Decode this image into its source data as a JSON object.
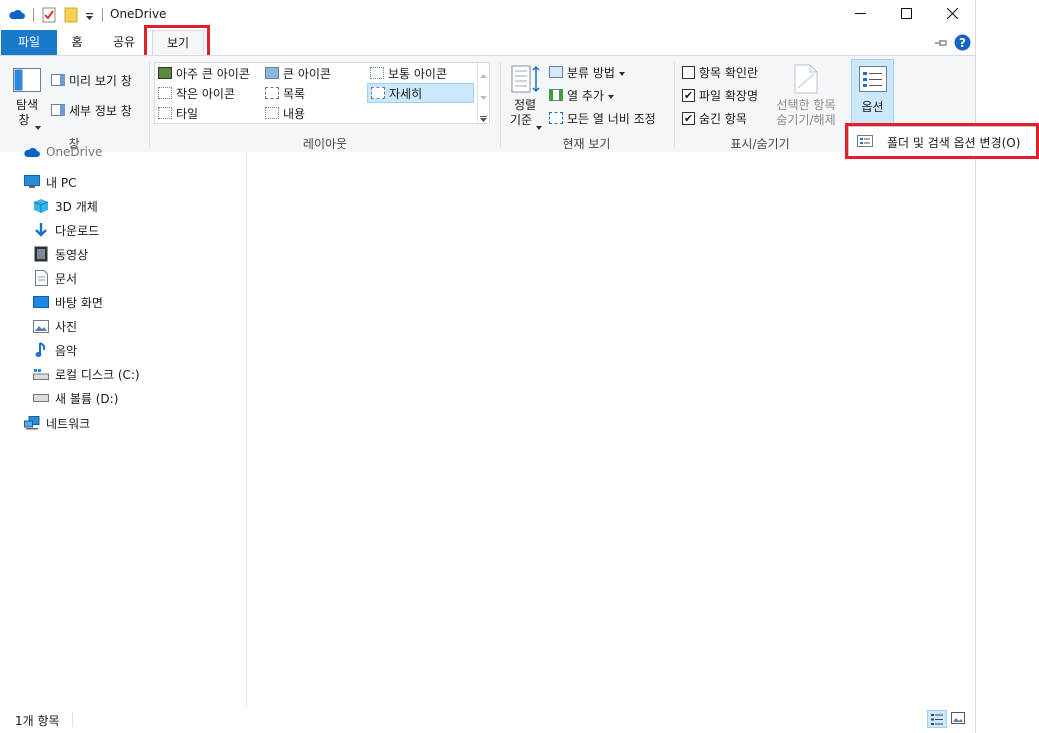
{
  "window": {
    "title": "OneDrive",
    "minimize_icon": "minimize-icon",
    "maximize_icon": "maximize-icon",
    "close_icon": "close-icon"
  },
  "tabs": [
    {
      "label": "파일"
    },
    {
      "label": "홈"
    },
    {
      "label": "공유"
    },
    {
      "label": "보기"
    }
  ],
  "ribbon": {
    "pane": {
      "nav_pane_label": "탐색",
      "nav_pane_label2": "창",
      "preview_label": "미리 보기 창",
      "details_label": "세부 정보 창",
      "group_label": "창"
    },
    "layout": {
      "items": [
        {
          "label": "아주 큰 아이콘"
        },
        {
          "label": "큰 아이콘"
        },
        {
          "label": "보통 아이콘"
        },
        {
          "label": "작은 아이콘"
        },
        {
          "label": "목록"
        },
        {
          "label": "자세히"
        },
        {
          "label": "타일"
        },
        {
          "label": "내용"
        }
      ],
      "group_label": "레이아웃"
    },
    "current_view": {
      "sort_label": "정렬",
      "sort_label2": "기준",
      "group_by_label": "분류 방법",
      "add_columns_label": "열 추가",
      "fit_columns_label": "모든 열 너비 조정",
      "group_label": "현재 보기"
    },
    "show_hide": {
      "item_checkboxes": {
        "label": "항목 확인란",
        "checked": false
      },
      "file_extensions": {
        "label": "파일 확장명",
        "checked": true
      },
      "hidden_items": {
        "label": "숨긴 항목",
        "checked": true
      },
      "hide_selected_label": "선택한 항목",
      "hide_selected_label2": "숨기기/해제",
      "group_label": "표시/숨기기"
    },
    "options": {
      "label": "옵션"
    }
  },
  "dropdown": {
    "item_label": "폴더 및 검색 옵션 변경",
    "item_mnemonic": "(O)"
  },
  "nav": {
    "onedrive_partial": "OneDrive",
    "items": [
      {
        "label": "내 PC",
        "icon": "pc-icon"
      },
      {
        "label": "3D 개체",
        "icon": "3d-objects-icon"
      },
      {
        "label": "다운로드",
        "icon": "download-icon"
      },
      {
        "label": "동영상",
        "icon": "videos-icon"
      },
      {
        "label": "문서",
        "icon": "documents-icon"
      },
      {
        "label": "바탕 화면",
        "icon": "desktop-icon"
      },
      {
        "label": "사진",
        "icon": "pictures-icon"
      },
      {
        "label": "음악",
        "icon": "music-icon"
      },
      {
        "label": "로컬 디스크 (C:)",
        "icon": "local-disk-icon"
      },
      {
        "label": "새 볼륨 (D:)",
        "icon": "drive-icon"
      },
      {
        "label": "네트워크",
        "icon": "network-icon"
      }
    ]
  },
  "status": {
    "item_count": "1개 항목"
  },
  "colors": {
    "file_tab": "#1979ca",
    "highlight": "#e0202a",
    "selection": "#cce8ff"
  }
}
